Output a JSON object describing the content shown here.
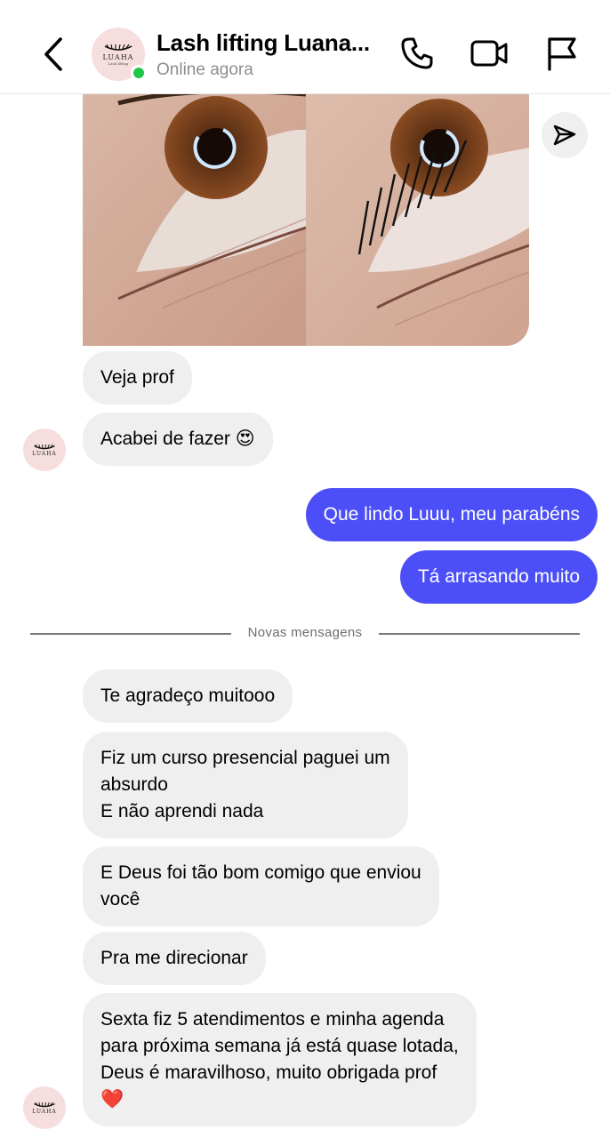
{
  "header": {
    "title": "Lash lifting Luana...",
    "status": "Online agora",
    "avatar_brand": "LUAHA",
    "avatar_sub": "Lash lifting",
    "icons": [
      "back-icon",
      "phone-icon",
      "video-icon",
      "flag-icon"
    ]
  },
  "colors": {
    "outgoing_bubble": "#4c4ff7",
    "incoming_bubble": "#efefef",
    "online": "#1fc64a"
  },
  "messages_before": [
    {
      "direction": "in",
      "text": "Veja prof"
    },
    {
      "direction": "in",
      "text": "Acabei de fazer 😍"
    },
    {
      "direction": "out",
      "text": "Que lindo Luuu, meu parabéns"
    },
    {
      "direction": "out",
      "text": "Tá arrasando muito"
    }
  ],
  "divider_label": "Novas mensagens",
  "messages_after": [
    {
      "direction": "in",
      "lines": [
        "Te agradeço muitooo"
      ]
    },
    {
      "direction": "in",
      "lines": [
        "Fiz um curso presencial paguei um",
        "absurdo",
        "E não aprendi nada"
      ]
    },
    {
      "direction": "in",
      "lines": [
        "E Deus foi tão bom comigo que enviou",
        "você"
      ]
    },
    {
      "direction": "in",
      "lines": [
        "Pra me direcionar"
      ]
    },
    {
      "direction": "in",
      "lines": [
        "Sexta fiz 5 atendimentos e minha agenda",
        "para próxima semana já está quase lotada,",
        "Deus é maravilhoso, muito obrigada prof",
        "❤️"
      ]
    }
  ]
}
